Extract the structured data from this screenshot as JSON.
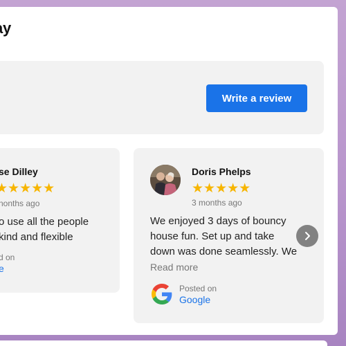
{
  "header": {
    "title": "ay"
  },
  "summary": {
    "write_review_label": "Write a review"
  },
  "reviews": [
    {
      "name": "se Dilley",
      "stars": "★★★★★",
      "date": "nonths ago",
      "text_line1": "o use all the people",
      "text_line2": "kind and flexible",
      "posted_label": "d on",
      "source": "e"
    },
    {
      "name": "Doris Phelps",
      "stars": "★★★★★",
      "date": "3 months ago",
      "text_line1": "We enjoyed 3 days of bouncy",
      "text_line2": "house fun. Set up and take",
      "text_line3": "down was done seamlessly. We",
      "read_more": "Read more",
      "posted_label": "Posted on",
      "source": "Google"
    }
  ],
  "colors": {
    "star": "#f7b500",
    "button": "#1a73e8",
    "link": "#1a73e8",
    "card_bg": "#f2f2f2"
  },
  "icons": {
    "next": "chevron-right-icon",
    "source_logo": "google-icon"
  }
}
